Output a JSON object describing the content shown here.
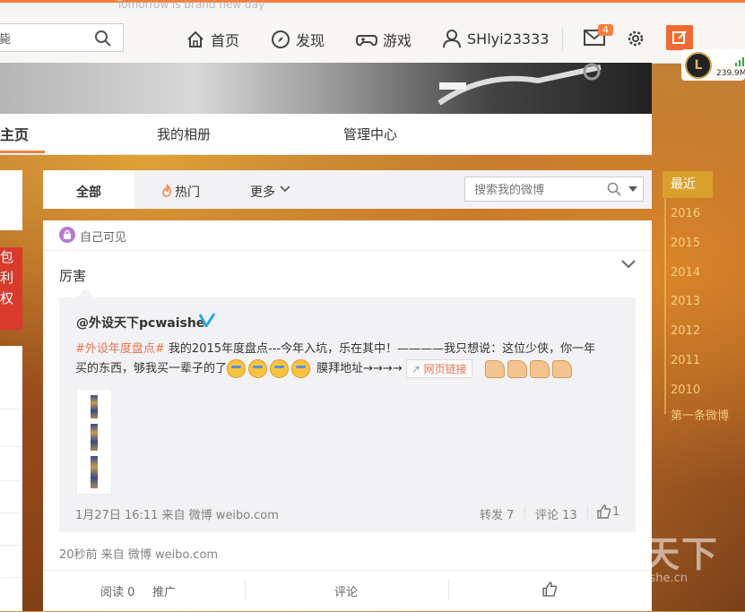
{
  "top": {
    "tagline": "Tomorrow is brand new day",
    "search_value": "毙",
    "nav": [
      {
        "label": "首页",
        "icon": "home-icon"
      },
      {
        "label": "发现",
        "icon": "compass-icon"
      },
      {
        "label": "游戏",
        "icon": "gamepad-icon"
      },
      {
        "label": "SHlyi23333",
        "icon": "user-icon"
      }
    ],
    "mail_badge": "4",
    "extension_speed": "239.9M"
  },
  "profile_tabs": {
    "active": "主页",
    "album": "我的相册",
    "manage": "管理中心"
  },
  "left_promo": [
    "包",
    "利",
    "权"
  ],
  "filter": {
    "all": "全部",
    "hot": "热门",
    "more": "更多",
    "search_placeholder": "搜索我的微博"
  },
  "post": {
    "visibility": "自己可见",
    "text": "厉害",
    "repost": {
      "author": "@外设天下pcwaishe",
      "hashtag": "#外设年度盘点#",
      "line1": " 我的2015年度盘点---今年入坑，乐在其中！————我只想说：这位少侠，你一年",
      "line2_a": "买的东西，够我买一辈子的了",
      "line2_b": " 膜拜地址→→→→",
      "link_label": "网页链接",
      "time_source": "1月27日 16:11 来自 微博 weibo.com",
      "forward": "转发 7",
      "comment": "评论 13",
      "likes": "1"
    },
    "time_source": "20秒前 来自 微博 weibo.com",
    "actions": {
      "read": "阅读 0",
      "promote": "推广",
      "comment": "评论"
    }
  },
  "timeline": {
    "active": "最近",
    "years": [
      "2016",
      "2015",
      "2014",
      "2013",
      "2012",
      "2011",
      "2010"
    ],
    "first": "第一条微博"
  },
  "watermark": {
    "cn": "外设天下",
    "url": "www.pcwaishe.cn"
  },
  "colors": {
    "accent": "#fa7d3c",
    "hashtag": "#eb7350",
    "timeline_active": "#d9a12c"
  }
}
